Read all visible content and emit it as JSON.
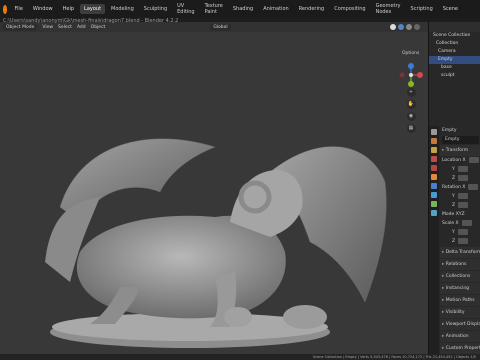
{
  "menubar": {
    "items": [
      "File",
      "Window",
      "Help"
    ],
    "workspaces": [
      "Layout",
      "Modeling",
      "Sculpting",
      "UV Editing",
      "Texture Paint",
      "Shading",
      "Animation",
      "Rendering",
      "Compositing",
      "Geometry Nodes",
      "Scripting"
    ],
    "active_workspace": "Layout",
    "scene_label": "Scene"
  },
  "window_title": "C:\\Users\\sandy\\anonym\\Gk\\mesh-finals\\dragon7.blend - Blender 4.2.2",
  "viewport": {
    "mode": "Object Mode",
    "menu": [
      "View",
      "Select",
      "Add",
      "Object"
    ],
    "transform": "Global",
    "options_label": "Options"
  },
  "outliner": {
    "title": "Scene Collection",
    "rows": [
      {
        "label": "Collection",
        "selected": false
      },
      {
        "label": "Camera",
        "selected": false
      },
      {
        "label": "Empty",
        "selected": true
      },
      {
        "label": "base",
        "selected": false
      },
      {
        "label": "sculpt",
        "selected": false
      }
    ]
  },
  "properties": {
    "object_name": "Empty",
    "object_field": "Empty",
    "transform_label": "Transform",
    "location_label": "Location X",
    "rows": [
      "Y",
      "Z"
    ],
    "rotation_label": "Rotation X",
    "rot_rows": [
      "Y",
      "Z"
    ],
    "mode_label": "Mode",
    "mode_value": "XYZ",
    "scale_label": "Scale X",
    "scale_rows": [
      "Y",
      "Z"
    ],
    "sections": [
      "Delta Transform",
      "Relations",
      "Collections",
      "Instancing",
      "Motion Paths",
      "Visibility",
      "Viewport Display",
      "Animation",
      "Custom Properties"
    ]
  },
  "status": "Scene Collection | Empty | Verts 5,543,476 | Faces 10,724,172 | Tris 21,454,452 | Objects 1/5"
}
